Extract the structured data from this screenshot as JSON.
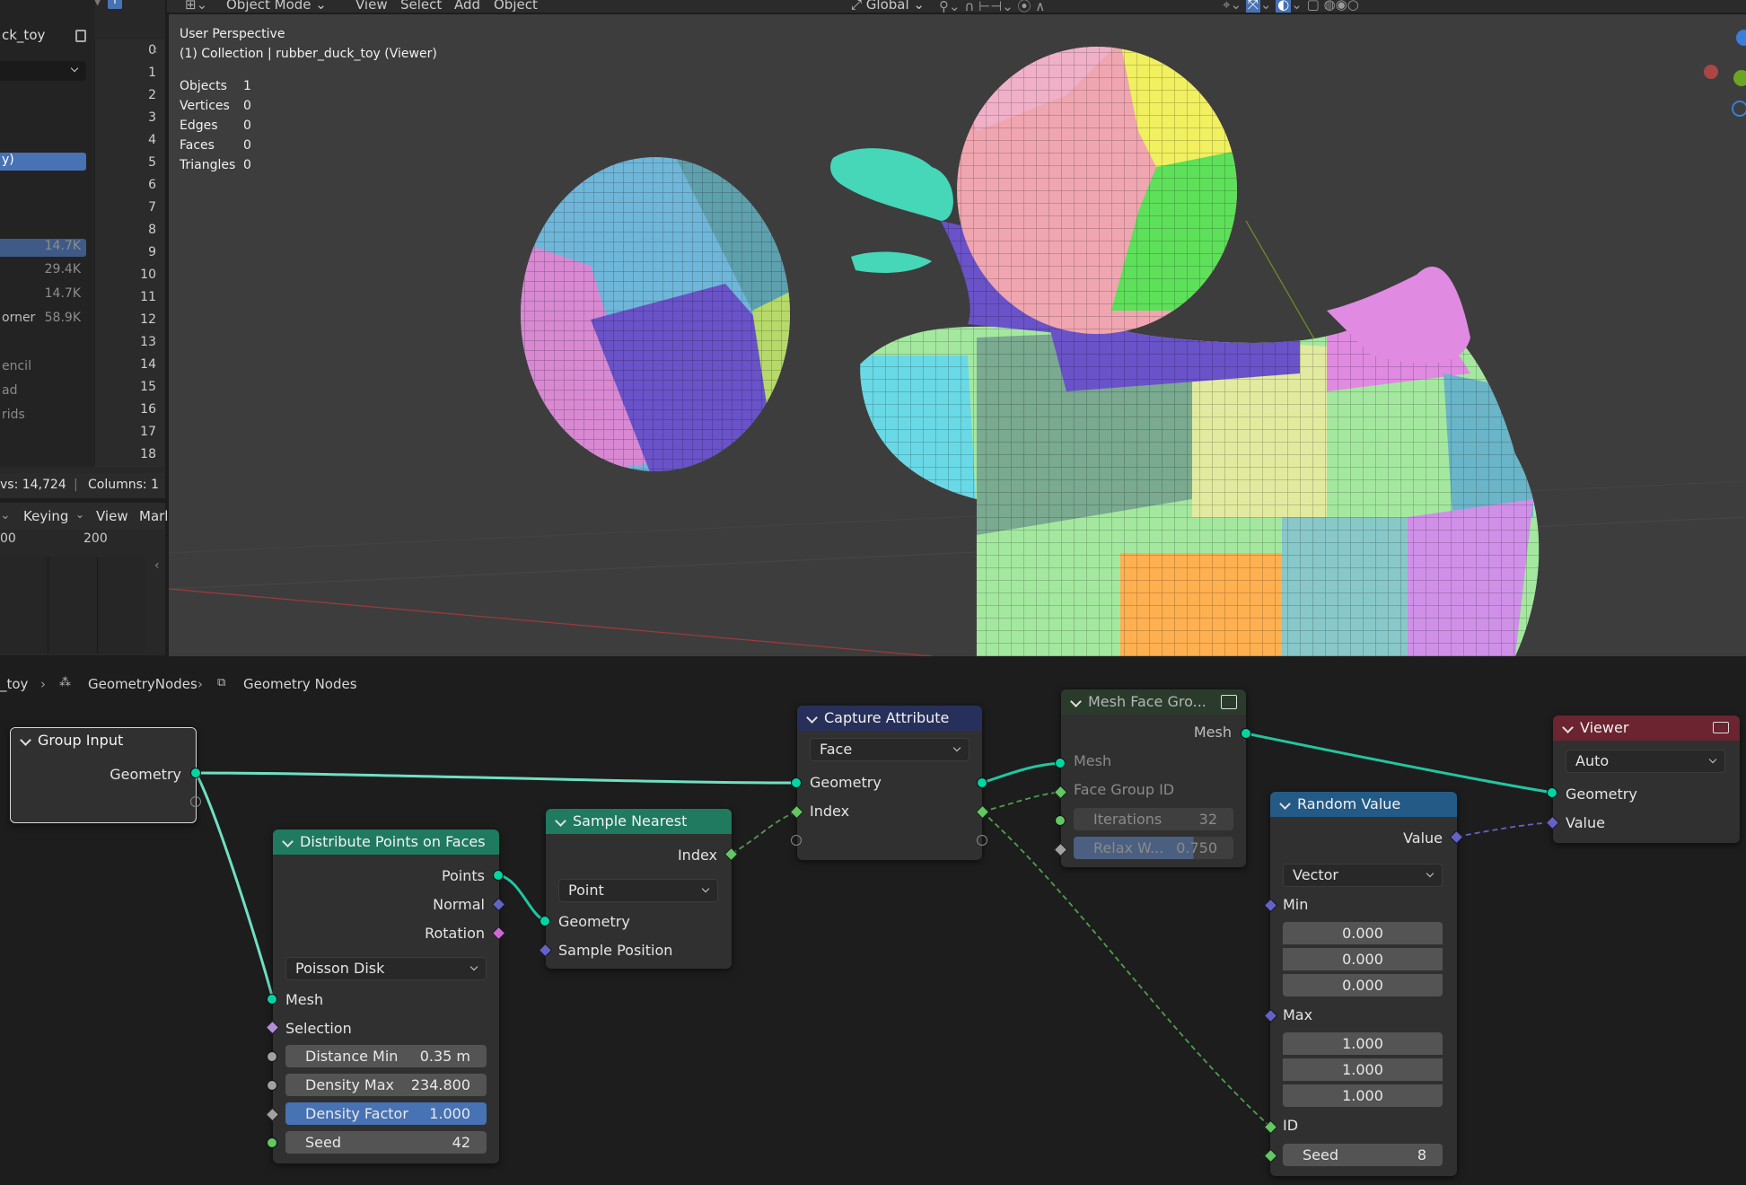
{
  "topbar": {
    "mode": "Object Mode",
    "menus": [
      "View",
      "Select",
      "Add",
      "Object"
    ],
    "orientation": "Global"
  },
  "outliner": {
    "object_name": "ck_toy",
    "items": [
      "y)",
      "14.7K",
      "29.4K",
      "14.7K",
      "orner",
      "58.9K",
      "encil",
      "ad",
      "rids"
    ]
  },
  "spreadsheet": {
    "indices": [
      "0",
      "1",
      "2",
      "3",
      "4",
      "5",
      "6",
      "7",
      "8",
      "9",
      "10",
      "11",
      "12",
      "13",
      "14",
      "15",
      "16",
      "17",
      "18"
    ],
    "rows_label": "vs: 14,724",
    "columns_label": "Columns: 1"
  },
  "timeline": {
    "keying": "Keying",
    "view": "View",
    "marker": "Marl",
    "ticks": [
      "00",
      "200"
    ]
  },
  "viewport": {
    "perspective": "User Perspective",
    "collection": "(1) Collection | rubber_duck_toy (Viewer)",
    "stats": [
      {
        "label": "Objects",
        "value": "1"
      },
      {
        "label": "Vertices",
        "value": "0"
      },
      {
        "label": "Edges",
        "value": "0"
      },
      {
        "label": "Faces",
        "value": "0"
      },
      {
        "label": "Triangles",
        "value": "0"
      }
    ]
  },
  "breadcrumb": {
    "object": "_toy",
    "modifier": "GeometryNodes",
    "tree": "Geometry Nodes"
  },
  "nodes": {
    "group_input": {
      "title": "Group Input",
      "geometry": "Geometry"
    },
    "distribute": {
      "title": "Distribute Points on Faces",
      "points": "Points",
      "normal": "Normal",
      "rotation": "Rotation",
      "mode": "Poisson Disk",
      "mesh": "Mesh",
      "selection": "Selection",
      "distance_min_label": "Distance Min",
      "distance_min": "0.35 m",
      "density_max_label": "Density Max",
      "density_max": "234.800",
      "density_factor_label": "Density Factor",
      "density_factor": "1.000",
      "seed_label": "Seed",
      "seed": "42"
    },
    "sample_nearest": {
      "title": "Sample Nearest",
      "index": "Index",
      "domain": "Point",
      "geometry": "Geometry",
      "sample_position": "Sample Position"
    },
    "capture": {
      "title": "Capture Attribute",
      "domain": "Face",
      "geometry": "Geometry",
      "index": "Index"
    },
    "mesh_face_group": {
      "title": "Mesh Face Gro...",
      "mesh_out": "Mesh",
      "mesh_in": "Mesh",
      "face_group_id": "Face Group ID",
      "iterations_label": "Iterations",
      "iterations": "32",
      "relax_label": "Relax W...",
      "relax": "0.750"
    },
    "random_value": {
      "title": "Random Value",
      "value": "Value",
      "type": "Vector",
      "min": "Min",
      "min_vals": [
        "0.000",
        "0.000",
        "0.000"
      ],
      "max": "Max",
      "max_vals": [
        "1.000",
        "1.000",
        "1.000"
      ],
      "id": "ID",
      "seed_label": "Seed",
      "seed": "8"
    },
    "viewer": {
      "title": "Viewer",
      "domain": "Auto",
      "geometry": "Geometry",
      "value": "Value"
    }
  },
  "colors": {
    "accent": "#4772b3",
    "geometry_socket": "#00d6a3",
    "group_input_header": "#3b3b3b",
    "distribute_header": "#1f7a5f",
    "capture_header": "#27305a",
    "sample_header": "#1f7a5f",
    "mfg_header": "#2b3b2b",
    "random_header": "#235a86",
    "viewer_header": "#6b2430"
  }
}
